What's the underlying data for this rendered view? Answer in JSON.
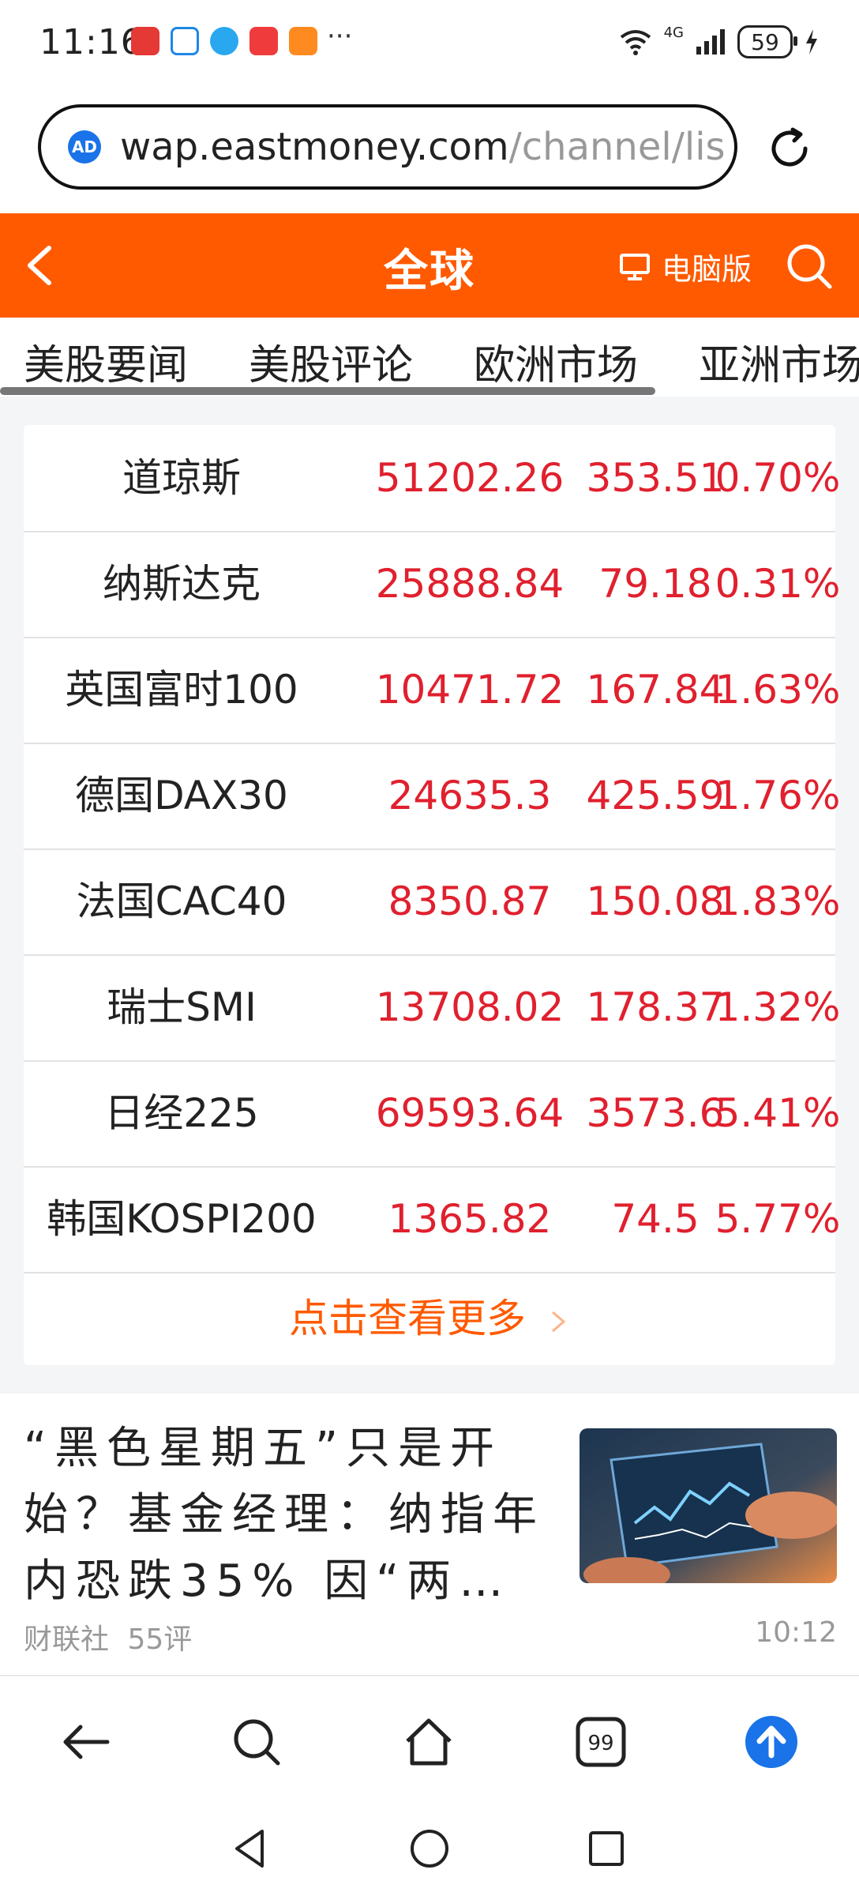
{
  "status_bar": {
    "time": "11:16",
    "overflow": "···",
    "network": "4G",
    "battery": "59"
  },
  "url_bar": {
    "ad_label": "AD",
    "host": "wap.eastmoney.com",
    "path": "/channel/lis"
  },
  "header": {
    "title": "全球",
    "pc_version": "电脑版"
  },
  "tabs": [
    {
      "label": "美股要闻"
    },
    {
      "label": "美股评论"
    },
    {
      "label": "欧洲市场"
    },
    {
      "label": "亚洲市场"
    }
  ],
  "indices": [
    {
      "name": "道琼斯",
      "price": "51202.26",
      "change": "353.51",
      "pct": "0.70%"
    },
    {
      "name": "纳斯达克",
      "price": "25888.84",
      "change": "79.18",
      "pct": "0.31%"
    },
    {
      "name": "英国富时100",
      "price": "10471.72",
      "change": "167.84",
      "pct": "1.63%"
    },
    {
      "name": "德国DAX30",
      "price": "24635.3",
      "change": "425.59",
      "pct": "1.76%"
    },
    {
      "name": "法国CAC40",
      "price": "8350.87",
      "change": "150.08",
      "pct": "1.83%"
    },
    {
      "name": "瑞士SMI",
      "price": "13708.02",
      "change": "178.37",
      "pct": "1.32%"
    },
    {
      "name": "日经225",
      "price": "69593.64",
      "change": "3573.6",
      "pct": "5.41%"
    },
    {
      "name": "韩国KOSPI200",
      "price": "1365.82",
      "change": "74.5",
      "pct": "5.77%"
    }
  ],
  "more_label": "点击查看更多",
  "news": {
    "title": "“黑色星期五”只是开始？基金经理：纳指年内恐跌35% 因“两…",
    "source": "财联社",
    "comments": "55评",
    "time": "10:12"
  },
  "colors": {
    "brand": "#ff5a00",
    "up": "#e0202e"
  }
}
